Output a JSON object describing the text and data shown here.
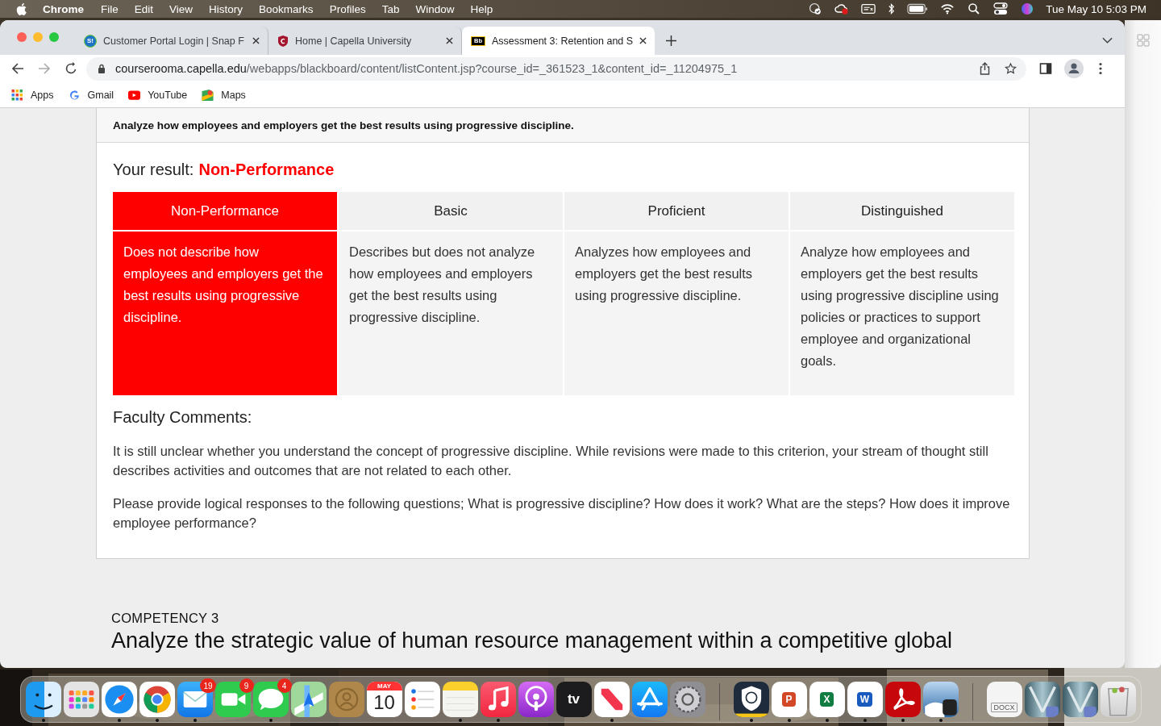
{
  "menubar": {
    "app": "Chrome",
    "menus": [
      "File",
      "Edit",
      "View",
      "History",
      "Bookmarks",
      "Profiles",
      "Tab",
      "Window",
      "Help"
    ],
    "clock": "Tue May 10  5:03 PM"
  },
  "tabs": [
    {
      "title": "Customer Portal Login | Snap F",
      "selected": false,
      "kind": "round",
      "icon_text": "S!"
    },
    {
      "title": "Home | Capella University",
      "selected": false,
      "kind": "shield"
    },
    {
      "title": "Assessment 3: Retention and S",
      "selected": true,
      "kind": "square",
      "icon_text": "Bb"
    }
  ],
  "address": {
    "host": "courserooma.capella.edu",
    "path": "/webapps/blackboard/content/listContent.jsp?course_id=_361523_1&content_id=_11204975_1"
  },
  "bookmarks": [
    {
      "label": "Apps",
      "kind": "apps"
    },
    {
      "label": "Gmail",
      "kind": "gmail"
    },
    {
      "label": "YouTube",
      "kind": "youtube"
    },
    {
      "label": "Maps",
      "kind": "maps"
    }
  ],
  "criterion": "Analyze how employees and employers get the best results using progressive discipline.",
  "result": {
    "label": "Your result:",
    "value": "Non-Performance"
  },
  "rubric": [
    {
      "level": "Non-Performance",
      "selected": true,
      "description": "Does not describe how employees and employers get the best results using progressive discipline."
    },
    {
      "level": "Basic",
      "selected": false,
      "description": "Describes but does not analyze how employees and employers get the best results using progressive discipline."
    },
    {
      "level": "Proficient",
      "selected": false,
      "description": "Analyzes how employees and employers get the best results using progressive discipline."
    },
    {
      "level": "Distinguished",
      "selected": false,
      "description": "Analyze how employees and employers get the best results using progressive discipline using policies or practices to support employee and organizational goals."
    }
  ],
  "faculty_comments": {
    "heading": "Faculty Comments:",
    "paragraphs": [
      "It is still unclear whether you understand the concept of progressive discipline. While revisions were made to this criterion, your stream of thought still describes activities and outcomes that are not related to each other.",
      "Please provide logical responses to the following questions; What is progressive discipline? How does it work? What are the steps? How does it improve employee performance?"
    ]
  },
  "competency": {
    "label": "COMPETENCY 3",
    "title": "Analyze the strategic value of human resource management within a competitive global"
  },
  "dock": [
    [
      {
        "kind": "finder",
        "running": true
      },
      {
        "kind": "launchpad",
        "running": false
      },
      {
        "kind": "safari",
        "running": true
      },
      {
        "kind": "chrome",
        "running": true
      },
      {
        "kind": "mail",
        "running": true,
        "badge": "19"
      },
      {
        "kind": "facetime",
        "running": false,
        "badge": "9"
      },
      {
        "kind": "messages",
        "running": true,
        "badge": "4"
      },
      {
        "kind": "maps",
        "running": false
      },
      {
        "kind": "contacts",
        "running": false
      },
      {
        "kind": "calendar",
        "running": false,
        "month": "MAY",
        "day": "10"
      },
      {
        "kind": "reminders",
        "running": false
      },
      {
        "kind": "notes",
        "running": true
      },
      {
        "kind": "music",
        "running": true
      },
      {
        "kind": "podcasts",
        "running": false
      },
      {
        "kind": "tv",
        "running": false,
        "label": "tv"
      },
      {
        "kind": "news",
        "running": true
      },
      {
        "kind": "appstore",
        "running": false
      },
      {
        "kind": "settings",
        "running": false
      }
    ],
    [
      {
        "kind": "shield",
        "running": true
      },
      {
        "kind": "slides",
        "running": true,
        "label": "P"
      },
      {
        "kind": "sheet",
        "running": true,
        "label": "X"
      },
      {
        "kind": "doc",
        "running": true,
        "label": "W"
      },
      {
        "kind": "pdf",
        "running": true
      },
      {
        "kind": "preview",
        "running": true
      }
    ],
    [
      {
        "kind": "file",
        "running": false,
        "label": "DOCX"
      },
      {
        "kind": "thumbnail",
        "running": false
      },
      {
        "kind": "thumbnail",
        "running": false
      },
      {
        "kind": "trash",
        "running": false
      }
    ]
  ]
}
